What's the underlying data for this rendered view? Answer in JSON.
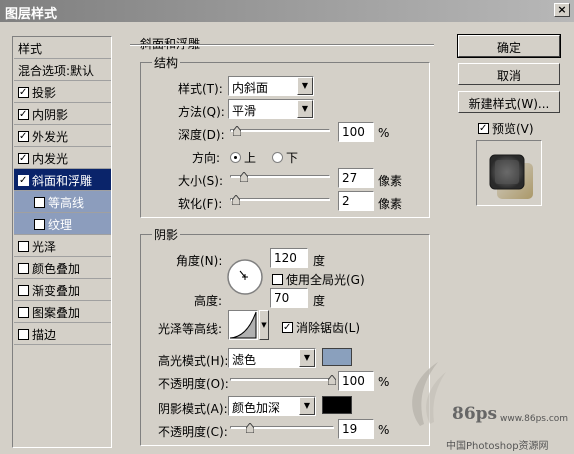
{
  "window": {
    "title": "图层样式",
    "close": "×"
  },
  "style_list": {
    "header": "样式",
    "blend_options": "混合选项:默认",
    "items": [
      {
        "label": "投影",
        "checked": true
      },
      {
        "label": "内阴影",
        "checked": true
      },
      {
        "label": "外发光",
        "checked": true
      },
      {
        "label": "内发光",
        "checked": true
      },
      {
        "label": "斜面和浮雕",
        "checked": true,
        "selected": true
      },
      {
        "label": "等高线",
        "checked": false,
        "sub": true
      },
      {
        "label": "纹理",
        "checked": false,
        "sub": true
      },
      {
        "label": "光泽",
        "checked": false
      },
      {
        "label": "颜色叠加",
        "checked": false
      },
      {
        "label": "渐变叠加",
        "checked": false
      },
      {
        "label": "图案叠加",
        "checked": false
      },
      {
        "label": "描边",
        "checked": false
      }
    ]
  },
  "bevel": {
    "section_title": "斜面和浮雕",
    "structure": {
      "title": "结构",
      "style_label": "样式(T):",
      "style_value": "内斜面",
      "technique_label": "方法(Q):",
      "technique_value": "平滑",
      "depth_label": "深度(D):",
      "depth_value": "100",
      "depth_unit": "%",
      "direction_label": "方向:",
      "direction_up": "上",
      "direction_down": "下",
      "size_label": "大小(S):",
      "size_value": "27",
      "size_unit": "像素",
      "soften_label": "软化(F):",
      "soften_value": "2",
      "soften_unit": "像素"
    },
    "shading": {
      "title": "阴影",
      "angle_label": "角度(N):",
      "angle_value": "120",
      "angle_unit": "度",
      "global_light_label": "使用全局光(G)",
      "altitude_label": "高度:",
      "altitude_value": "70",
      "altitude_unit": "度",
      "gloss_contour_label": "光泽等高线:",
      "antialias_label": "消除锯齿(L)",
      "highlight_mode_label": "高光模式(H):",
      "highlight_mode_value": "滤色",
      "highlight_color": "#8aa0bd",
      "highlight_opacity_label": "不透明度(O):",
      "highlight_opacity_value": "100",
      "highlight_opacity_unit": "%",
      "shadow_mode_label": "阴影模式(A):",
      "shadow_mode_value": "颜色加深",
      "shadow_color": "#000000",
      "shadow_opacity_label": "不透明度(C):",
      "shadow_opacity_value": "19",
      "shadow_opacity_unit": "%"
    }
  },
  "buttons": {
    "ok": "确定",
    "cancel": "取消",
    "new_style": "新建样式(W)...",
    "preview": "预览(V)"
  },
  "watermark": {
    "logo": "86ps",
    "url": "www.86ps.com",
    "site": "中国Photoshop资源网"
  }
}
